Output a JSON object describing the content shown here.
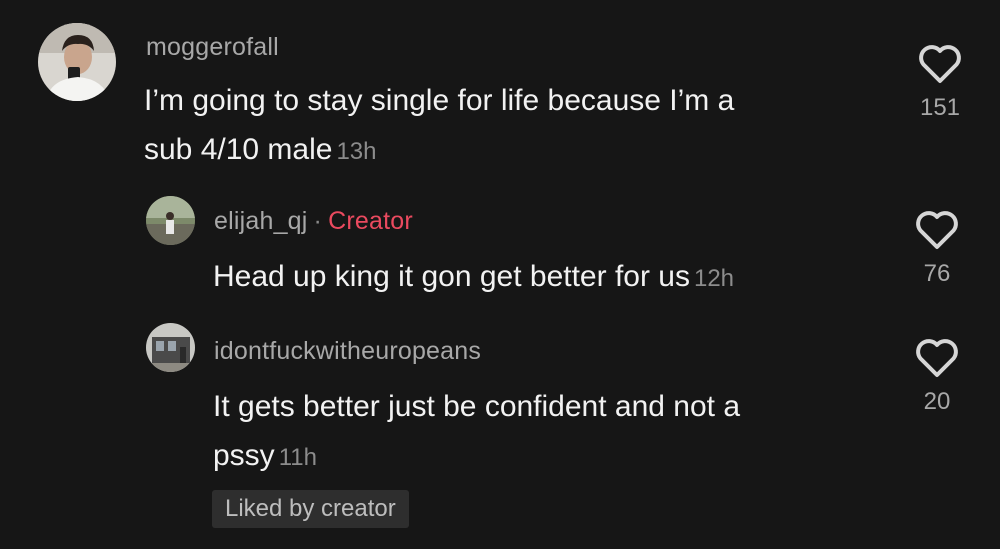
{
  "comments": [
    {
      "username": "moggerofall",
      "text_line1": "I’m going to stay single for life because I’m a",
      "text_line2": "sub 4/10 male",
      "timestamp": "13h",
      "likes": "151",
      "avatar_icon": "profile-photo-man-holding-phone",
      "like_icon": "heart-outline-icon"
    },
    {
      "username": "elijah_qj",
      "separator": "·",
      "badge": "Creator",
      "text": "Head up king it gon get better for us",
      "timestamp": "12h",
      "likes": "76",
      "avatar_icon": "profile-photo-person-standing-outdoors",
      "like_icon": "heart-outline-icon"
    },
    {
      "username": "idontfuckwitheuropeans",
      "text_line1": "It gets better just be confident and not a",
      "text_line2": "pssy",
      "timestamp": "11h",
      "likes": "20",
      "liked_by_label": "Liked by creator",
      "avatar_icon": "profile-photo-building",
      "like_icon": "heart-outline-icon"
    }
  ],
  "colors": {
    "background": "#161616",
    "creator_accent": "#ea4a5f",
    "text_primary": "#f2f2f2",
    "text_secondary": "#a8a8a8"
  }
}
